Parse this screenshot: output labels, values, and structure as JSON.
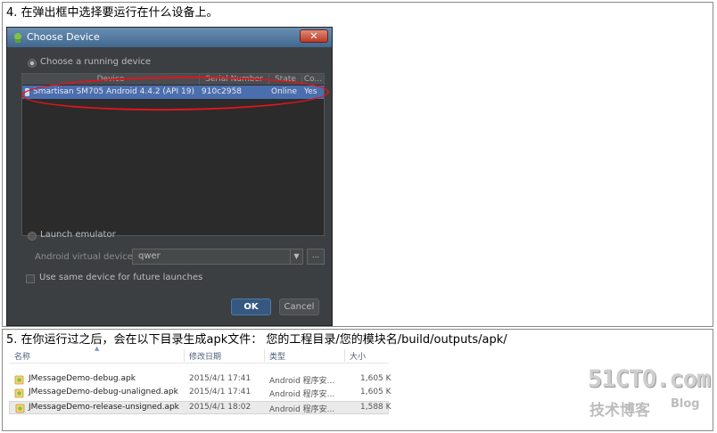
{
  "step4_text": "4. 在弹出框中选择要运行在什么设备上。",
  "step5_text": "5. 在你运行过之后，会在以下目录生成apk文件：  您的工程目录/您的模块名/build/outputs/apk/",
  "dialog": {
    "title": "Choose Device",
    "close_label": "✕",
    "running_device_label": "Choose a running device",
    "columns": {
      "device": "Device",
      "serial": "Serial Number",
      "state": "State",
      "compatible": "Co..."
    },
    "device_row": {
      "device": "Smartisan SM705 Android 4.4.2 (API 19)",
      "serial": "910c2958",
      "state": "Online",
      "compatible": "Yes"
    },
    "launch_emulator_label": "Launch emulator",
    "avd_label": "Android virtual device:",
    "avd_value": "qwer",
    "ellipsis_label": "...",
    "same_device_label": "Use same device for future launches",
    "ok_label": "OK",
    "cancel_label": "Cancel"
  },
  "explorer": {
    "headers": {
      "name": "名称",
      "date": "修改日期",
      "type": "类型",
      "size": "大小"
    },
    "files": [
      {
        "name": "JMessageDemo-debug.apk",
        "date": "2015/4/1 17:41",
        "type": "Android 程序安...",
        "size": "1,605 K"
      },
      {
        "name": "JMessageDemo-debug-unaligned.apk",
        "date": "2015/4/1 17:41",
        "type": "Android 程序安...",
        "size": "1,605 K"
      },
      {
        "name": "JMessageDemo-release-unsigned.apk",
        "date": "2015/4/1 18:02",
        "type": "Android 程序安...",
        "size": "1,588 K"
      }
    ]
  },
  "watermark": {
    "site": "51CTO.com",
    "cn": "技术博客",
    "blog": "Blog"
  },
  "colors": {
    "dialog_bg": "#3c3f41",
    "selection": "#4b6eaf",
    "highlight_oval": "#e0151c",
    "ok_button": "#365880"
  }
}
